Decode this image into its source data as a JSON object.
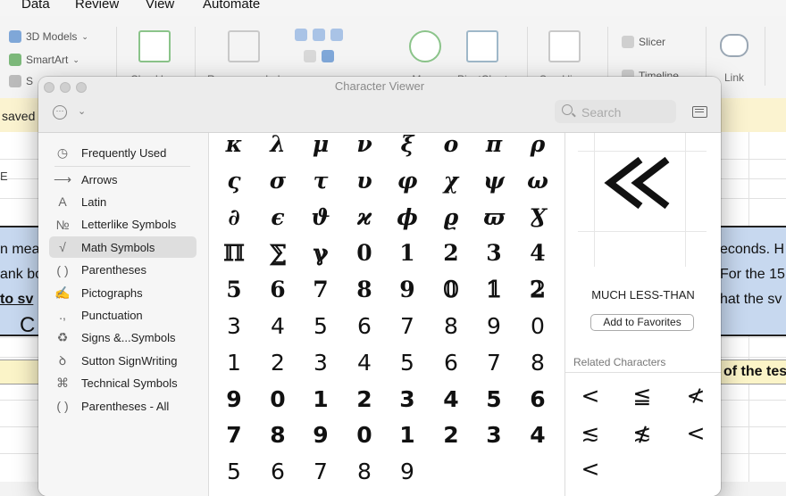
{
  "excel": {
    "menu": [
      "Data",
      "Review",
      "View",
      "Automate"
    ],
    "ribbon": {
      "small_items": [
        "3D Models",
        "SmartArt",
        "S"
      ],
      "groups": [
        "Checkbox",
        "Recommended",
        "Maps",
        "PivotChart",
        "Sparklines",
        "Slicer",
        "Timeline",
        "Link",
        "C"
      ]
    },
    "message_fragment": "saved",
    "sheet_texts": {
      "col_letter": "E",
      "row1_left": "n mea",
      "row2_left": "ank bo",
      "row3_left": "to sv",
      "row4_left": "C",
      "row1_right": "econds. H",
      "row2_right": "For the 15",
      "row3_right": "hat the sv",
      "yellow_right": "of the tes"
    }
  },
  "viewer": {
    "title": "Character Viewer",
    "search_placeholder": "Search",
    "sidebar": [
      {
        "icon": "clock-icon",
        "glyph": "◷",
        "label": "Frequently Used"
      },
      {
        "icon": "arrow-icon",
        "glyph": "⟶",
        "label": "Arrows"
      },
      {
        "icon": "latin-icon",
        "glyph": "A",
        "label": "Latin"
      },
      {
        "icon": "numero-icon",
        "glyph": "№",
        "label": "Letterlike Symbols"
      },
      {
        "icon": "sqrt-icon",
        "glyph": "√",
        "label": "Math Symbols",
        "selected": true
      },
      {
        "icon": "parentheses-icon",
        "glyph": "( )",
        "label": "Parentheses"
      },
      {
        "icon": "pen-icon",
        "glyph": "✍",
        "label": "Pictographs"
      },
      {
        "icon": "punctuation-icon",
        "glyph": ".,",
        "label": "Punctuation"
      },
      {
        "icon": "recycle-icon",
        "glyph": "♻",
        "label": "Signs &...Symbols"
      },
      {
        "icon": "signwriting-icon",
        "glyph": "ꝺ",
        "label": "Sutton SignWriting"
      },
      {
        "icon": "command-icon",
        "glyph": "⌘",
        "label": "Technical Symbols"
      },
      {
        "icon": "parentheses-icon",
        "glyph": "( )",
        "label": "Parentheses - All"
      }
    ],
    "grid_rows": [
      {
        "style": "italic",
        "glyphs": [
          "κ",
          "λ",
          "μ",
          "ν",
          "ξ",
          "ο",
          "π",
          "ρ"
        ]
      },
      {
        "style": "italic",
        "glyphs": [
          "ς",
          "σ",
          "τ",
          "υ",
          "φ",
          "χ",
          "ψ",
          "ω"
        ]
      },
      {
        "style": "italic",
        "glyphs": [
          "∂",
          "ϵ",
          "ϑ",
          "ϰ",
          "ϕ",
          "ϱ",
          "ϖ",
          "Ɣ"
        ]
      },
      {
        "style": "bold",
        "glyphs": [
          "ℿ",
          "⅀",
          "ℽ",
          "0",
          "1",
          "2",
          "3",
          "4"
        ]
      },
      {
        "style": "bold",
        "glyphs": [
          "5",
          "6",
          "7",
          "8",
          "9",
          "𝟘",
          "𝟙",
          "𝟚"
        ]
      },
      {
        "style": "plain",
        "glyphs": [
          "3",
          "4",
          "5",
          "6",
          "7",
          "8",
          "9",
          "0"
        ]
      },
      {
        "style": "plain",
        "glyphs": [
          "1",
          "2",
          "3",
          "4",
          "5",
          "6",
          "7",
          "8"
        ]
      },
      {
        "style": "boldplain",
        "glyphs": [
          "9",
          "0",
          "1",
          "2",
          "3",
          "4",
          "5",
          "6"
        ]
      },
      {
        "style": "boldplain",
        "glyphs": [
          "7",
          "8",
          "9",
          "0",
          "1",
          "2",
          "3",
          "4"
        ]
      },
      {
        "style": "plain",
        "glyphs": [
          "5",
          "6",
          "7",
          "8",
          "9"
        ]
      }
    ],
    "detail": {
      "preview_glyph": "≪",
      "name": "MUCH LESS-THAN",
      "fav_label": "Add to Favorites",
      "related_label": "Related Characters",
      "related": [
        "<",
        "≦",
        "≮",
        "≲",
        "≴",
        "<",
        "<"
      ]
    }
  }
}
